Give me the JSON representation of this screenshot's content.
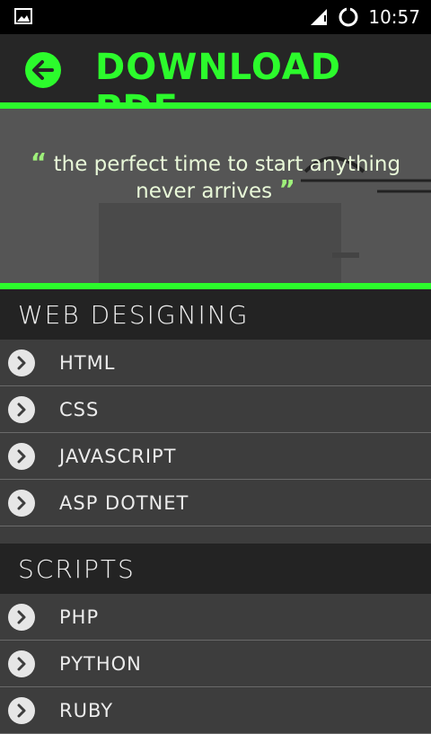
{
  "status_bar": {
    "time": "10:57",
    "icons": [
      "image-icon",
      "signal-icon",
      "sync-icon"
    ]
  },
  "header": {
    "title": "DOWNLOAD PDF",
    "back_icon": "arrow-left-icon",
    "accent_color": "#2cfb2c"
  },
  "banner": {
    "quote_line1": "the perfect time to start anything",
    "quote_line2": "never arrives",
    "open_quote": "“",
    "close_quote": "”"
  },
  "sections": [
    {
      "title": "WEB DESIGNING",
      "items": [
        {
          "label": "HTML"
        },
        {
          "label": "CSS"
        },
        {
          "label": "JAVASCRIPT"
        },
        {
          "label": "ASP DOTNET"
        }
      ]
    },
    {
      "title": "SCRIPTS",
      "items": [
        {
          "label": "PHP"
        },
        {
          "label": "PYTHON"
        },
        {
          "label": "RUBY"
        }
      ]
    }
  ]
}
